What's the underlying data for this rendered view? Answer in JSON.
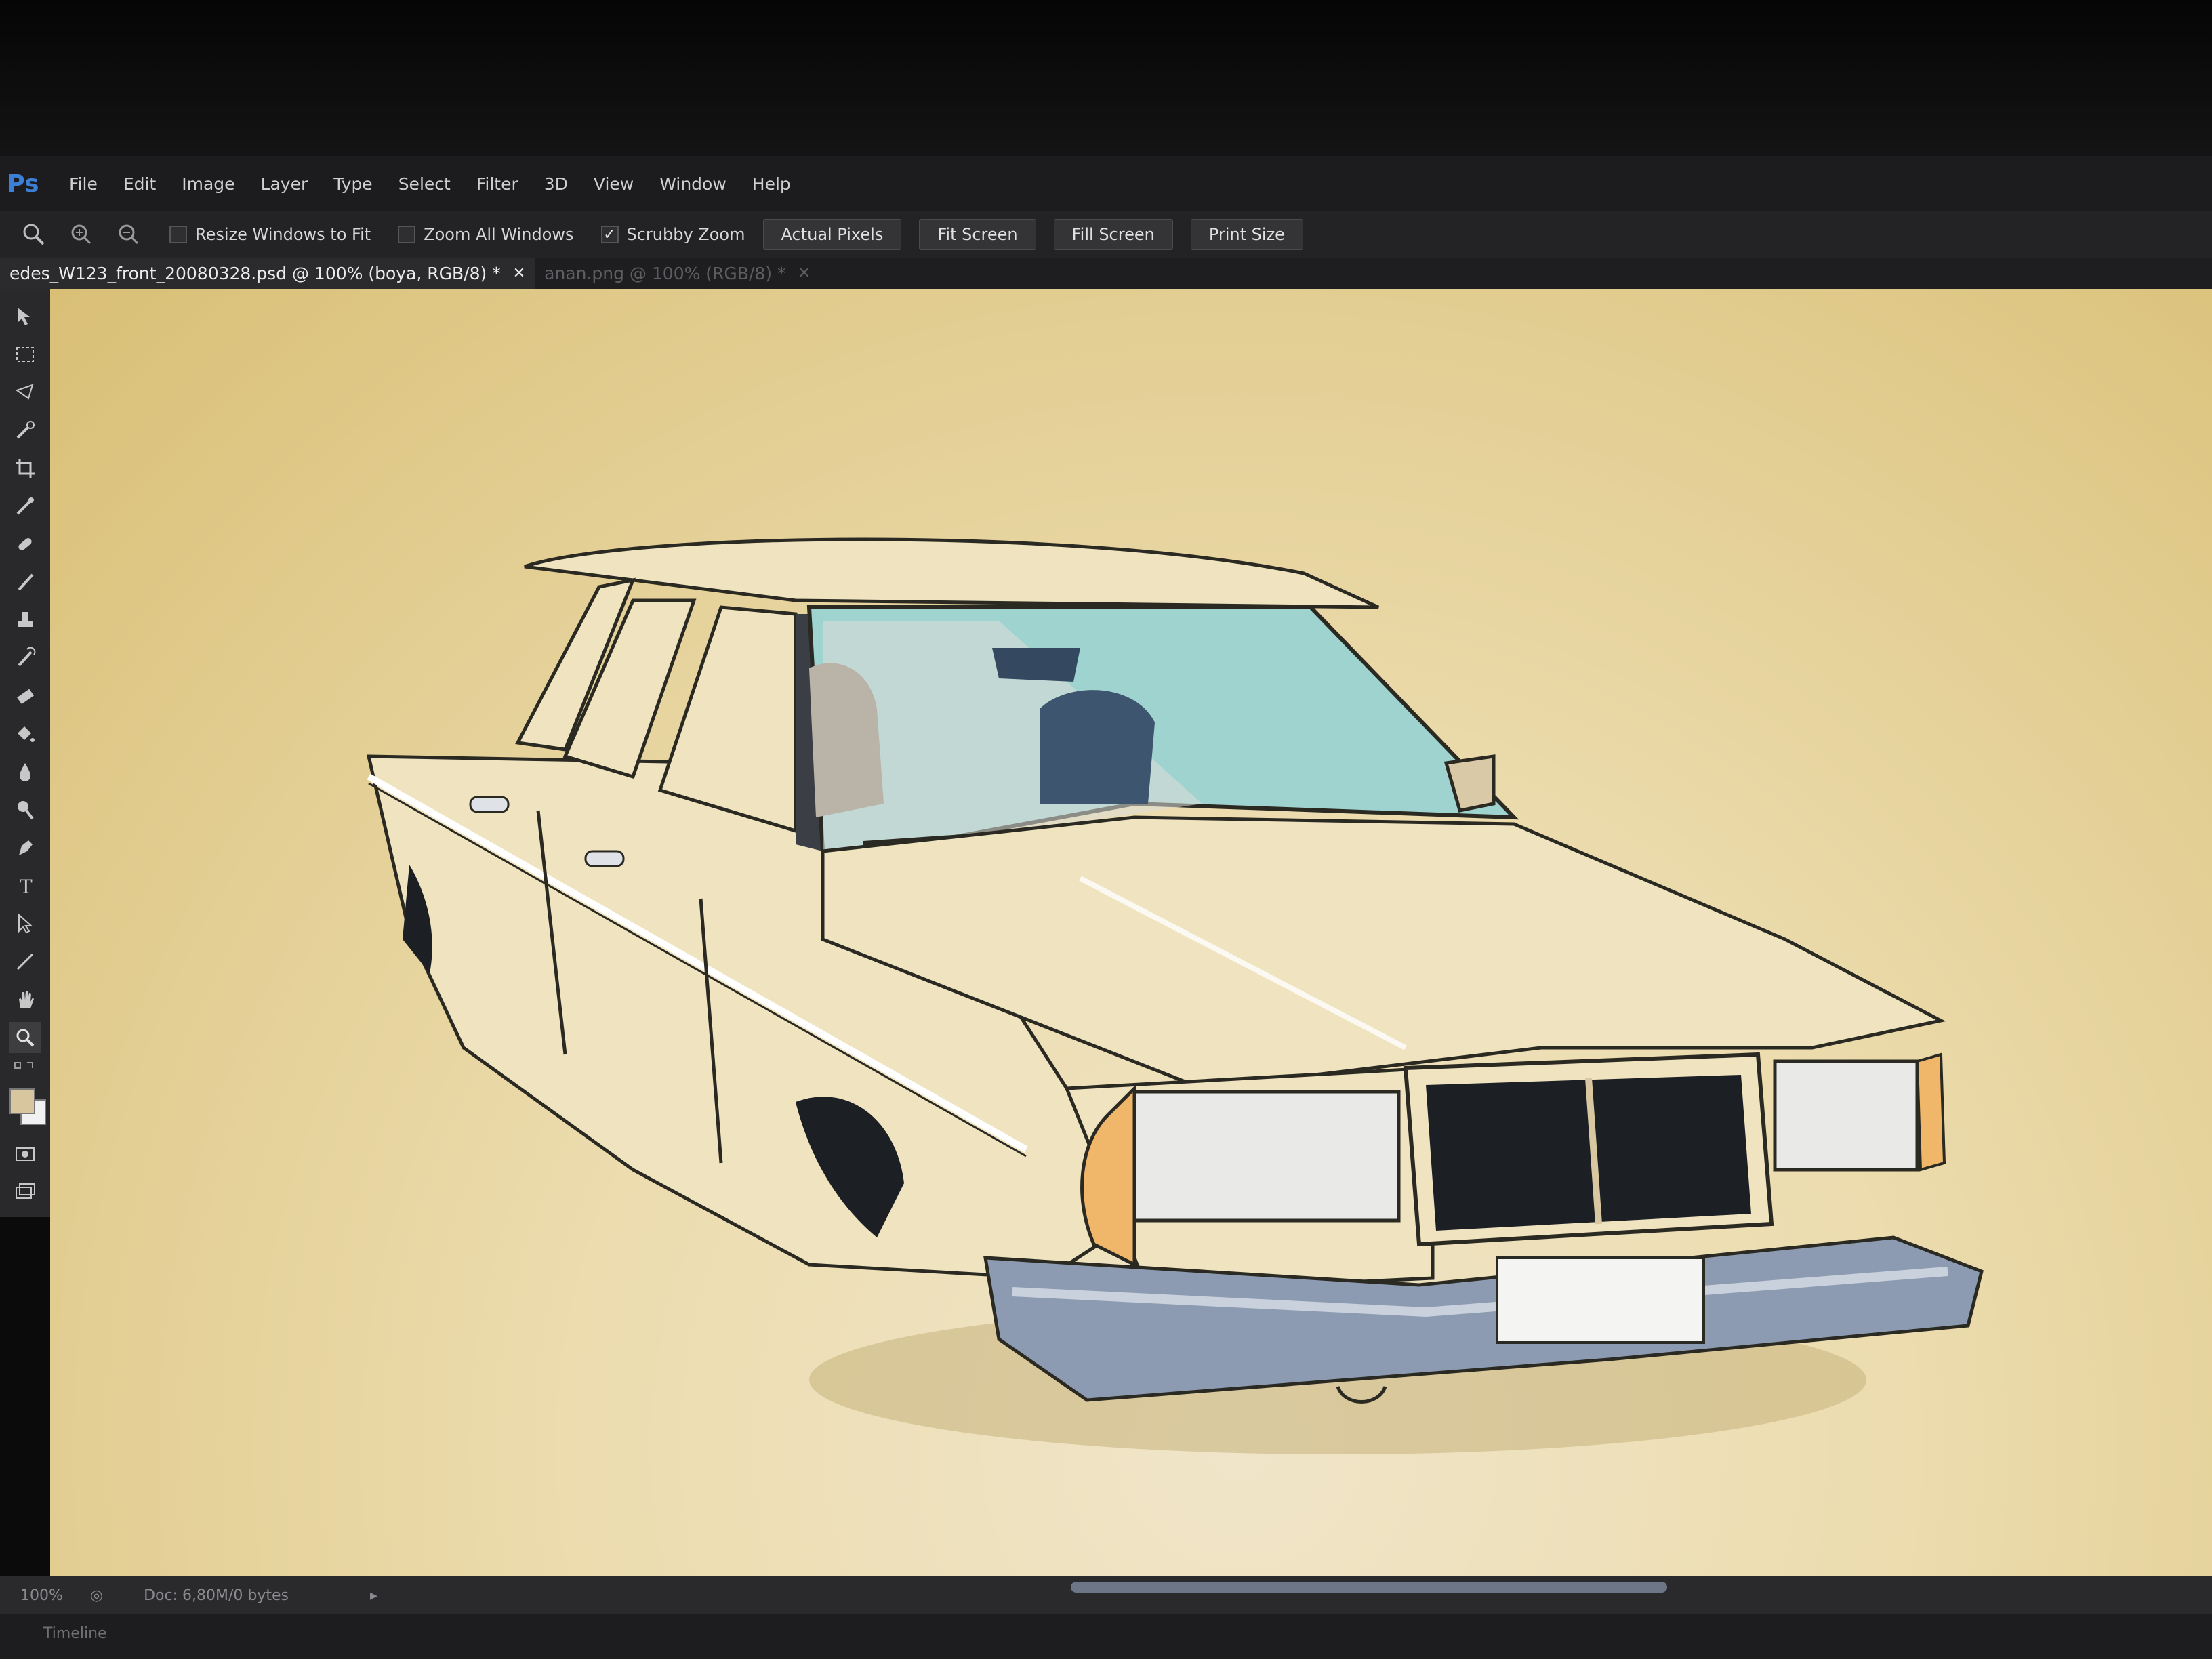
{
  "menu": [
    "File",
    "Edit",
    "Image",
    "Layer",
    "Type",
    "Select",
    "Filter",
    "3D",
    "View",
    "Window",
    "Help"
  ],
  "options": {
    "resize_windows": "Resize Windows to Fit",
    "zoom_all": "Zoom All Windows",
    "scrubby_zoom": "Scrubby Zoom",
    "actual_pixels": "Actual Pixels",
    "fit_screen": "Fit Screen",
    "fill_screen": "Fill Screen",
    "print_size": "Print Size"
  },
  "tabs": [
    {
      "title": "edes_W123_front_20080328.psd @ 100% (boya, RGB/8) *",
      "active": true
    },
    {
      "title": "anan.png @ 100% (RGB/8) *",
      "active": false
    }
  ],
  "status": {
    "zoom": "100%",
    "doc": "Doc: 6,80M/0 bytes"
  },
  "timeline_label": "Timeline",
  "tools": [
    "move-icon",
    "marquee-icon",
    "lasso-icon",
    "quick-select-icon",
    "crop-icon",
    "eyedropper-icon",
    "healing-icon",
    "brush-icon",
    "stamp-icon",
    "history-brush-icon",
    "eraser-icon",
    "bucket-icon",
    "blur-icon",
    "dodge-icon",
    "pen-icon",
    "type-icon",
    "path-select-icon",
    "line-icon",
    "hand-icon",
    "zoom-icon"
  ],
  "colors": {
    "foreground": "#d8c79e",
    "background": "#f1f1f1",
    "car_body": "#efe2bf",
    "glass": "#9fd3cf",
    "grille": "#1c2025",
    "bumper": "#8d9bb2"
  }
}
